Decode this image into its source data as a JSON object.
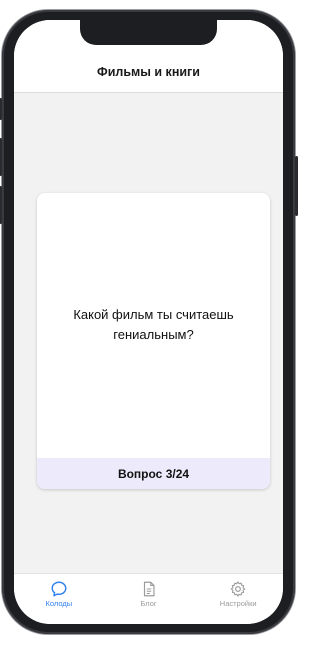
{
  "header": {
    "title": "Фильмы и книги"
  },
  "card": {
    "question": "Какой фильм ты считаешь гениальным?",
    "counter": "Вопрос 3/24"
  },
  "tabbar": {
    "items": [
      {
        "label": "Колоды",
        "icon": "chat-bubble-icon",
        "active": true
      },
      {
        "label": "Блог",
        "icon": "document-icon",
        "active": false
      },
      {
        "label": "Настройки",
        "icon": "gear-icon",
        "active": false
      }
    ]
  },
  "colors": {
    "accent": "#2f80ed",
    "card_footer": "#edeafb",
    "background": "#f2f2f2"
  }
}
